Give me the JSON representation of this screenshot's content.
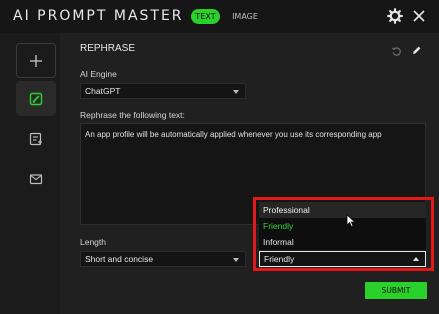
{
  "header": {
    "app_title": "AI PROMPT MASTER",
    "tabs": [
      {
        "label": "TEXT",
        "active": true
      },
      {
        "label": "IMAGE",
        "active": false
      }
    ],
    "accent_color": "#2bd12b"
  },
  "sidebar": {
    "items": [
      {
        "icon": "plus-icon"
      },
      {
        "icon": "rephrase-icon",
        "selected": true
      },
      {
        "icon": "list-edit-icon"
      },
      {
        "icon": "mail-icon"
      }
    ]
  },
  "main": {
    "section_title": "REPHRASE",
    "engine": {
      "label": "AI Engine",
      "value": "ChatGPT"
    },
    "rephrase": {
      "label": "Rephrase the following text:",
      "text": "An app profile will be automatically applied whenever you use its corresponding app"
    },
    "length": {
      "label": "Length",
      "value": "Short and concise"
    },
    "tone": {
      "value": "Friendly",
      "options": [
        "Professional",
        "Friendly",
        "Informal"
      ]
    },
    "submit_label": "SUBMIT"
  },
  "highlight_color": "#e31919"
}
